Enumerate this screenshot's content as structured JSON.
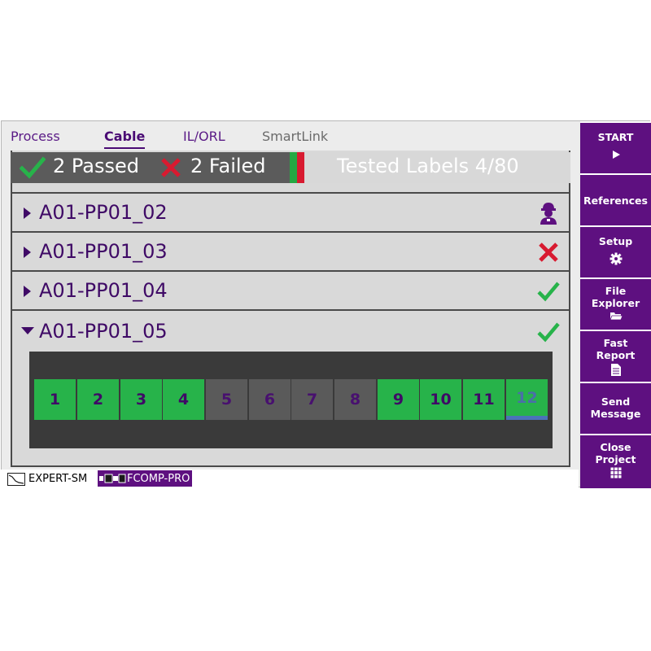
{
  "tabs": [
    {
      "label": "Process",
      "state": "normal"
    },
    {
      "label": "Cable",
      "state": "active"
    },
    {
      "label": "IL/ORL",
      "state": "normal"
    },
    {
      "label": "SmartLink",
      "state": "disabled"
    }
  ],
  "status": {
    "passed": "2 Passed",
    "failed": "2 Failed",
    "tested_labels": "Tested Labels 4/80"
  },
  "rows": [
    {
      "label": "A01-PP01_02",
      "status": "worker-icon"
    },
    {
      "label": "A01-PP01_03",
      "status": "fail-icon"
    },
    {
      "label": "A01-PP01_04",
      "status": "pass-icon"
    },
    {
      "label": "A01-PP01_05",
      "status": "pass-icon",
      "expanded": true
    }
  ],
  "fibers": [
    {
      "n": "1",
      "state": "pass"
    },
    {
      "n": "2",
      "state": "pass"
    },
    {
      "n": "3",
      "state": "pass"
    },
    {
      "n": "4",
      "state": "pass"
    },
    {
      "n": "5",
      "state": "none"
    },
    {
      "n": "6",
      "state": "none"
    },
    {
      "n": "7",
      "state": "none"
    },
    {
      "n": "8",
      "state": "none"
    },
    {
      "n": "9",
      "state": "pass"
    },
    {
      "n": "10",
      "state": "pass"
    },
    {
      "n": "11",
      "state": "pass"
    },
    {
      "n": "12",
      "state": "selected"
    }
  ],
  "sidebar": {
    "start": "START",
    "references": "References",
    "setup": "Setup",
    "file_explorer_1": "File",
    "file_explorer_2": "Explorer",
    "fast_report_1": "Fast",
    "fast_report_2": "Report",
    "send_message_1": "Send",
    "send_message_2": "Message",
    "close_project_1": "Close",
    "close_project_2": "Project"
  },
  "footer": {
    "module1": "EXPERT-SM",
    "module2": "FCOMP-PRO"
  },
  "colors": {
    "purple": "#5e1080",
    "pass_green": "#27b34a",
    "fail_red": "#d81a30"
  }
}
